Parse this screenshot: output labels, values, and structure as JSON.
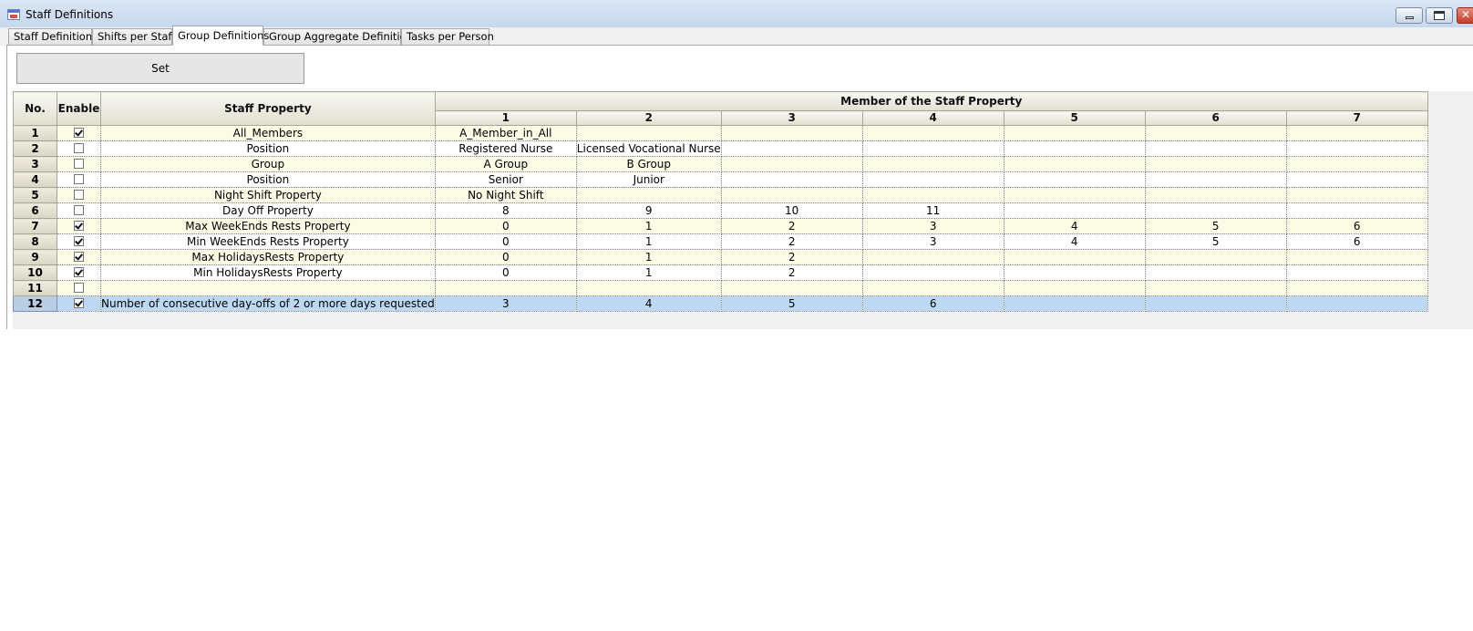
{
  "window": {
    "title": "Staff Definitions"
  },
  "tabs": [
    {
      "label": "Staff Definitions"
    },
    {
      "label": "Shifts per Staff"
    },
    {
      "label": "Group Definitions",
      "active": true
    },
    {
      "label": "Group Aggregate Definitions"
    },
    {
      "label": "Tasks per Person"
    }
  ],
  "set_button": {
    "label": "Set"
  },
  "grid": {
    "headers": {
      "no": "No.",
      "enable": "Enable",
      "property": "Staff Property",
      "members": "Member of the Staff Property",
      "member_columns": [
        "1",
        "2",
        "3",
        "4",
        "5",
        "6",
        "7"
      ]
    },
    "rows": [
      {
        "no": "1",
        "enabled": true,
        "property": "All_Members",
        "members": [
          "A_Member_in_All",
          "",
          "",
          "",
          "",
          "",
          ""
        ]
      },
      {
        "no": "2",
        "enabled": false,
        "property": "Position",
        "members": [
          "Registered Nurse",
          "Licensed Vocational Nurse",
          "",
          "",
          "",
          "",
          ""
        ]
      },
      {
        "no": "3",
        "enabled": false,
        "property": "Group",
        "members": [
          "A Group",
          "B Group",
          "",
          "",
          "",
          "",
          ""
        ]
      },
      {
        "no": "4",
        "enabled": false,
        "property": "Position",
        "members": [
          "Senior",
          "Junior",
          "",
          "",
          "",
          "",
          ""
        ]
      },
      {
        "no": "5",
        "enabled": false,
        "property": "Night Shift Property",
        "members": [
          "No Night Shift",
          "",
          "",
          "",
          "",
          "",
          ""
        ]
      },
      {
        "no": "6",
        "enabled": false,
        "property": "Day Off Property",
        "members": [
          "8",
          "9",
          "10",
          "11",
          "",
          "",
          ""
        ]
      },
      {
        "no": "7",
        "enabled": true,
        "property": "Max WeekEnds Rests Property",
        "members": [
          "0",
          "1",
          "2",
          "3",
          "4",
          "5",
          "6"
        ]
      },
      {
        "no": "8",
        "enabled": true,
        "property": "Min WeekEnds Rests Property",
        "members": [
          "0",
          "1",
          "2",
          "3",
          "4",
          "5",
          "6"
        ]
      },
      {
        "no": "9",
        "enabled": true,
        "property": "Max HolidaysRests Property",
        "members": [
          "0",
          "1",
          "2",
          "",
          "",
          "",
          ""
        ]
      },
      {
        "no": "10",
        "enabled": true,
        "property": "Min HolidaysRests Property",
        "members": [
          "0",
          "1",
          "2",
          "",
          "",
          "",
          ""
        ]
      },
      {
        "no": "11",
        "enabled": false,
        "property": "",
        "members": [
          "",
          "",
          "",
          "",
          "",
          "",
          ""
        ]
      },
      {
        "no": "12",
        "enabled": true,
        "property": "Number of consecutive day-offs of 2 or more days requested",
        "members": [
          "3",
          "4",
          "5",
          "6",
          "",
          "",
          ""
        ],
        "selected": true
      }
    ]
  }
}
